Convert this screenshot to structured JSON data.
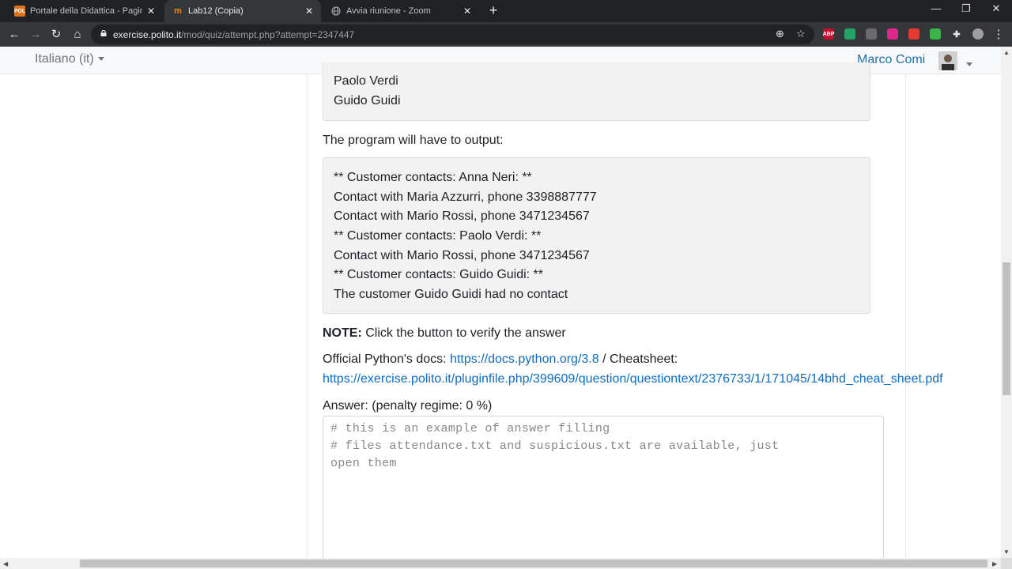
{
  "browser": {
    "tabs": [
      {
        "title": "Portale della Didattica - Pagina c",
        "favicon": "POL",
        "favicon_color": "#d9741d",
        "active": false
      },
      {
        "title": "Lab12 (Copia)",
        "favicon": "m",
        "favicon_color": "#f98012",
        "active": true
      },
      {
        "title": "Avvia riunione - Zoom",
        "favicon": "globe-icon",
        "favicon_color": "#9aa0a6",
        "active": false
      }
    ],
    "url_host": "exercise.polito.it",
    "url_path": "/mod/quiz/attempt.php?attempt=2347447",
    "extensions": [
      {
        "name": "adblock-plus-icon",
        "label": "ABP",
        "color": "#c70d2c"
      },
      {
        "name": "sheets-extension-icon",
        "label": "",
        "color": "#21a464"
      },
      {
        "name": "extension-grey-icon",
        "label": "",
        "color": "#6b6b6b"
      },
      {
        "name": "extension-pink-icon",
        "label": "",
        "color": "#e0288c"
      },
      {
        "name": "extension-calendar-icon",
        "label": "",
        "color": "#e53935"
      },
      {
        "name": "extension-green-icon",
        "label": "",
        "color": "#39b54a"
      },
      {
        "name": "extensions-puzzle-icon",
        "label": "",
        "color": "#35363a"
      },
      {
        "name": "profile-icon",
        "label": "",
        "color": "#9e9e9e"
      }
    ]
  },
  "navbar": {
    "language": "Italiano (it)",
    "user_name": "Marco Comi"
  },
  "question": {
    "input_box_lines": [
      "Paolo Verdi",
      "Guido Guidi"
    ],
    "output_intro": "The program will have to output:",
    "output_lines": [
      "** Customer contacts: Anna Neri: **",
      "Contact with Maria Azzurri, phone 3398887777",
      "Contact with Mario Rossi, phone 3471234567",
      "** Customer contacts: Paolo Verdi: **",
      "Contact with Mario Rossi, phone 3471234567",
      "** Customer contacts: Guido Guidi: **",
      "The customer Guido Guidi had no contact"
    ],
    "note_label": "NOTE:",
    "note_text": " Click the button to verify the answer",
    "docs_prefix": "Official Python's docs: ",
    "docs_link": "https://docs.python.org/3.8",
    "docs_sep": " / Cheatsheet:",
    "cheatsheet_link": "https://exercise.polito.it/pluginfile.php/399609/question/questiontext/2376733/1/171045/14bhd_cheat_sheet.pdf",
    "answer_label": "Answer:  (penalty regime: 0 %)",
    "answer_code_lines": [
      "# this is an example of answer filling",
      "# files attendance.txt and suspicious.txt are available, just",
      "open them"
    ]
  }
}
